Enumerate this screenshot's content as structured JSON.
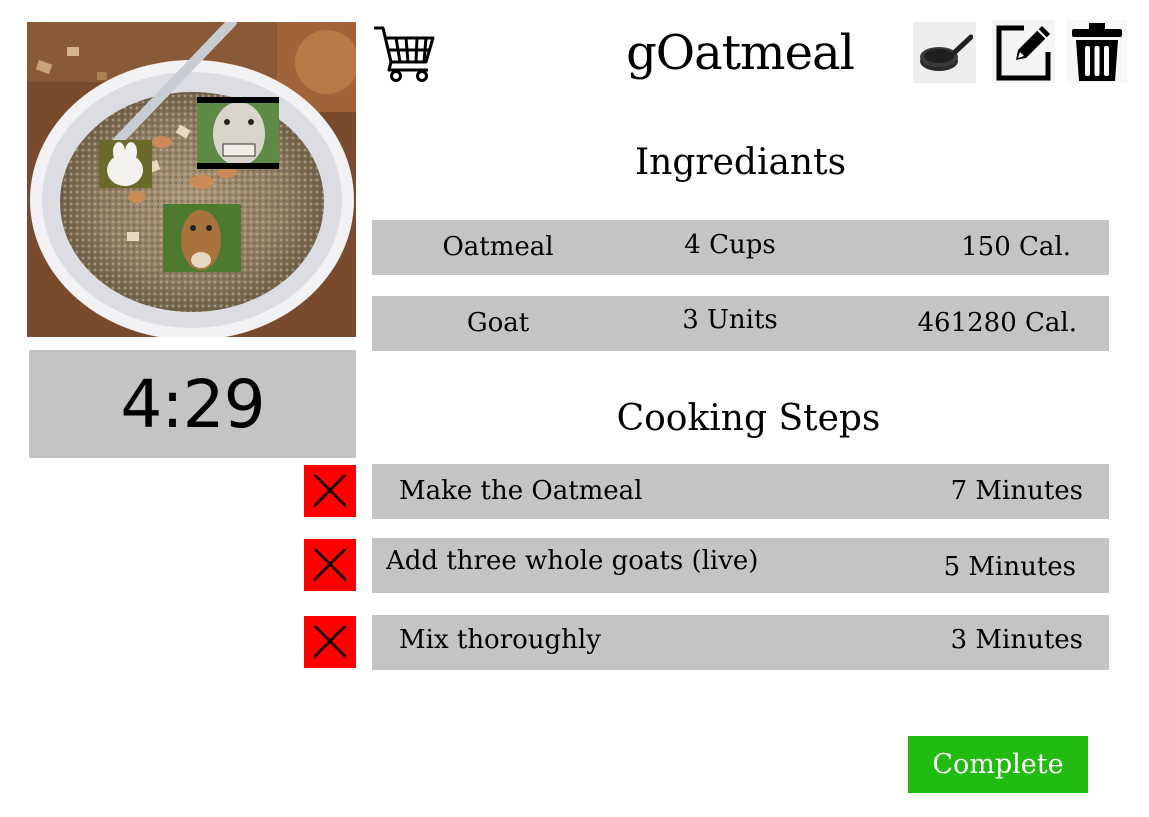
{
  "header": {
    "title": "gOatmeal",
    "icons": [
      "shopping-cart-icon",
      "frying-pan-icon",
      "edit-icon",
      "trash-icon"
    ]
  },
  "timer": {
    "value": "4:29"
  },
  "ingredients": {
    "heading": "Ingrediants",
    "rows": [
      {
        "name": "Oatmeal",
        "amount": "4 Cups",
        "calories": "150 Cal."
      },
      {
        "name": "Goat",
        "amount": "3 Units",
        "calories": "461280 Cal."
      }
    ]
  },
  "steps": {
    "heading": "Cooking Steps",
    "items": [
      {
        "name": "Make the Oatmeal",
        "duration": "7 Minutes"
      },
      {
        "name": "Add three whole goats (live)",
        "duration": "5 Minutes"
      },
      {
        "name": "Mix thoroughly",
        "duration": "3 Minutes"
      }
    ]
  },
  "actions": {
    "complete_label": "Complete"
  },
  "colors": {
    "row_bg": "#c4c4c4",
    "remove_red": "#ff0000",
    "complete_green": "#22bb11"
  }
}
